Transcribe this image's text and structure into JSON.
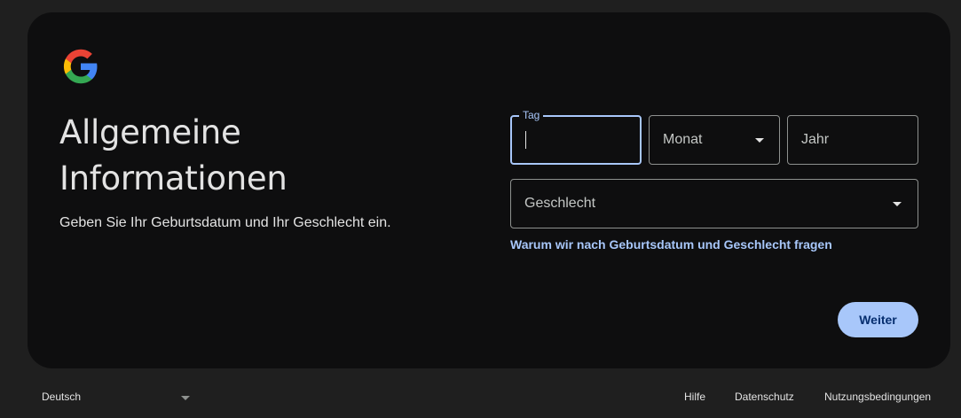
{
  "header": {
    "logo": "google-g-logo",
    "title_line1": "Allgemeine",
    "title_line2": "Informationen",
    "subtitle": "Geben Sie Ihr Geburtsdatum und Ihr Geschlecht ein."
  },
  "form": {
    "day": {
      "label": "Tag",
      "value": ""
    },
    "month": {
      "placeholder": "Monat",
      "icon": "dropdown-arrow-icon"
    },
    "year": {
      "placeholder": "Jahr"
    },
    "gender": {
      "placeholder": "Geschlecht",
      "icon": "dropdown-arrow-icon"
    },
    "why_link": "Warum wir nach Geburtsdatum und Geschlecht fragen",
    "next_button": "Weiter"
  },
  "footer": {
    "language": "Deutsch",
    "links": [
      "Hilfe",
      "Datenschutz",
      "Nutzungsbedingungen"
    ]
  },
  "colors": {
    "page_bg": "#1f1f1f",
    "card_bg": "#0e0e0f",
    "accent": "#a8c7fa",
    "button_text": "#062e6f",
    "border": "#8e918f"
  }
}
